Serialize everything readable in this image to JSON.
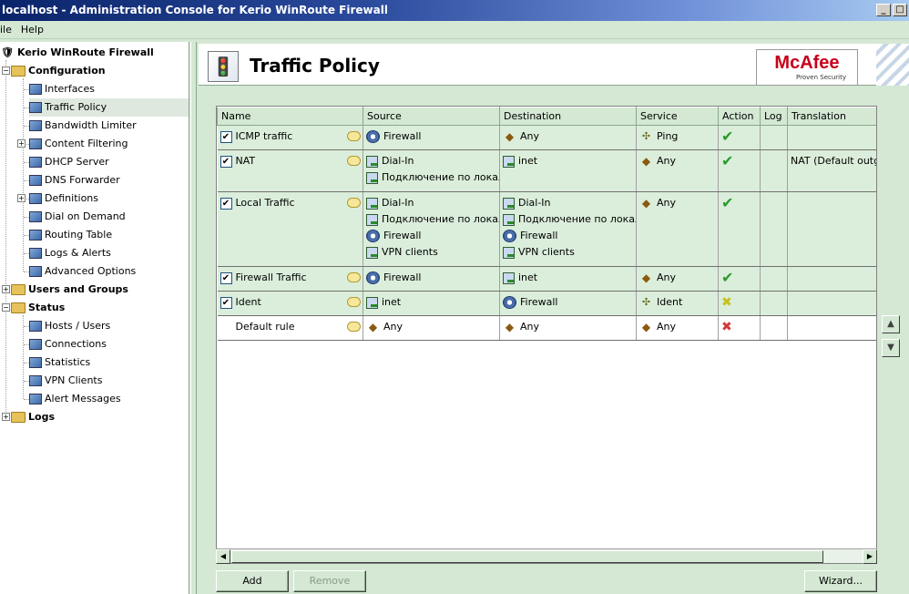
{
  "window": {
    "title": "localhost - Administration Console for Kerio WinRoute Firewall",
    "minimize": "_",
    "maximize": "□"
  },
  "menu": [
    "ile",
    "Help"
  ],
  "tree": {
    "root": "Kerio WinRoute Firewall",
    "configuration": "Configuration",
    "config_items": [
      {
        "label": "Interfaces",
        "icon": "interfaces-icon"
      },
      {
        "label": "Traffic Policy",
        "icon": "traffic-policy-icon"
      },
      {
        "label": "Bandwidth Limiter",
        "icon": "bandwidth-icon"
      },
      {
        "label": "Content Filtering",
        "icon": "folder-icon"
      },
      {
        "label": "DHCP Server",
        "icon": "dhcp-icon"
      },
      {
        "label": "DNS Forwarder",
        "icon": "dns-icon"
      },
      {
        "label": "Definitions",
        "icon": "definitions-icon"
      },
      {
        "label": "Dial on Demand",
        "icon": "dial-icon"
      },
      {
        "label": "Routing Table",
        "icon": "routing-icon"
      },
      {
        "label": "Logs & Alerts",
        "icon": "logs-alerts-icon"
      },
      {
        "label": "Advanced Options",
        "icon": "advanced-icon"
      }
    ],
    "users_groups": "Users and Groups",
    "status": "Status",
    "status_items": [
      {
        "label": "Hosts / Users",
        "icon": "hosts-icon"
      },
      {
        "label": "Connections",
        "icon": "connections-icon"
      },
      {
        "label": "Statistics",
        "icon": "statistics-icon"
      },
      {
        "label": "VPN Clients",
        "icon": "vpn-icon"
      },
      {
        "label": "Alert Messages",
        "icon": "alert-icon"
      }
    ],
    "logs": "Logs"
  },
  "header": {
    "title": "Traffic Policy",
    "logo_brand": "McAfee",
    "logo_tag": "Proven Security"
  },
  "table": {
    "columns": [
      "Name",
      "Source",
      "Destination",
      "Service",
      "Action",
      "Log",
      "Translation"
    ],
    "rows": [
      {
        "checked": true,
        "name": "ICMP traffic",
        "source": [
          {
            "t": "Firewall",
            "i": "fw"
          }
        ],
        "destination": [
          {
            "t": "Any",
            "i": "any"
          }
        ],
        "service": [
          {
            "t": "Ping",
            "i": "svc"
          }
        ],
        "action": "permit",
        "translation": ""
      },
      {
        "checked": true,
        "name": "NAT",
        "source": [
          {
            "t": "Dial-In",
            "i": "net"
          },
          {
            "t": "Подключение по локальной сети",
            "i": "net"
          }
        ],
        "destination": [
          {
            "t": "inet",
            "i": "net"
          }
        ],
        "service": [
          {
            "t": "Any",
            "i": "any"
          }
        ],
        "action": "permit",
        "translation": "NAT (Default outgoing)"
      },
      {
        "checked": true,
        "name": "Local Traffic",
        "source": [
          {
            "t": "Dial-In",
            "i": "net"
          },
          {
            "t": "Подключение по локальной сети",
            "i": "net"
          },
          {
            "t": "Firewall",
            "i": "fw"
          },
          {
            "t": "VPN clients",
            "i": "net"
          }
        ],
        "destination": [
          {
            "t": "Dial-In",
            "i": "net"
          },
          {
            "t": "Подключение по локальной сети",
            "i": "net"
          },
          {
            "t": "Firewall",
            "i": "fw"
          },
          {
            "t": "VPN clients",
            "i": "net"
          }
        ],
        "service": [
          {
            "t": "Any",
            "i": "any"
          }
        ],
        "action": "permit",
        "translation": ""
      },
      {
        "checked": true,
        "name": "Firewall Traffic",
        "source": [
          {
            "t": "Firewall",
            "i": "fw"
          }
        ],
        "destination": [
          {
            "t": "inet",
            "i": "net"
          }
        ],
        "service": [
          {
            "t": "Any",
            "i": "any"
          }
        ],
        "action": "permit",
        "translation": ""
      },
      {
        "checked": true,
        "name": "Ident",
        "source": [
          {
            "t": "inet",
            "i": "net"
          }
        ],
        "destination": [
          {
            "t": "Firewall",
            "i": "fw"
          }
        ],
        "service": [
          {
            "t": "Ident",
            "i": "svc"
          }
        ],
        "action": "drop",
        "translation": ""
      },
      {
        "checked": false,
        "name": "Default rule",
        "source": [
          {
            "t": "Any",
            "i": "any"
          }
        ],
        "destination": [
          {
            "t": "Any",
            "i": "any"
          }
        ],
        "service": [
          {
            "t": "Any",
            "i": "any"
          }
        ],
        "action": "deny",
        "translation": ""
      }
    ]
  },
  "buttons": {
    "add": "Add",
    "remove": "Remove",
    "wizard": "Wizard..."
  }
}
